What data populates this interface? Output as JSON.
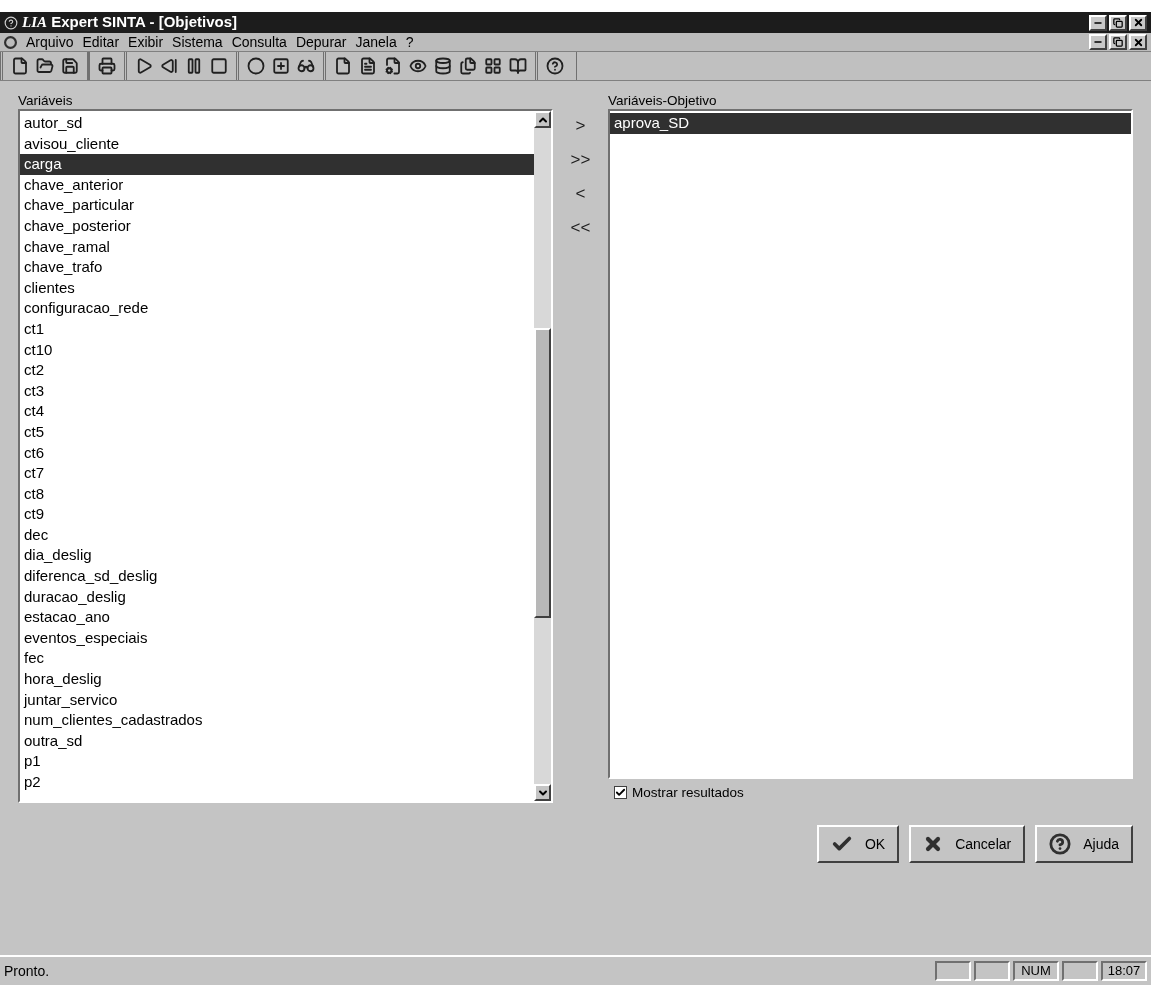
{
  "window": {
    "title_brand": "LIA",
    "title": "Expert SINTA - [Objetivos]"
  },
  "menu": [
    "Arquivo",
    "Editar",
    "Exibir",
    "Sistema",
    "Consulta",
    "Depurar",
    "Janela",
    "?"
  ],
  "variables": {
    "label": "Variáveis",
    "items": [
      {
        "text": "autor_sd",
        "selected": false
      },
      {
        "text": "avisou_cliente",
        "selected": false
      },
      {
        "text": "carga",
        "selected": true
      },
      {
        "text": "chave_anterior",
        "selected": false
      },
      {
        "text": "chave_particular",
        "selected": false
      },
      {
        "text": "chave_posterior",
        "selected": false
      },
      {
        "text": "chave_ramal",
        "selected": false
      },
      {
        "text": "chave_trafo",
        "selected": false
      },
      {
        "text": "clientes",
        "selected": false
      },
      {
        "text": "configuracao_rede",
        "selected": false
      },
      {
        "text": "ct1",
        "selected": false
      },
      {
        "text": "ct10",
        "selected": false
      },
      {
        "text": "ct2",
        "selected": false
      },
      {
        "text": "ct3",
        "selected": false
      },
      {
        "text": "ct4",
        "selected": false
      },
      {
        "text": "ct5",
        "selected": false
      },
      {
        "text": "ct6",
        "selected": false
      },
      {
        "text": "ct7",
        "selected": false
      },
      {
        "text": "ct8",
        "selected": false
      },
      {
        "text": "ct9",
        "selected": false
      },
      {
        "text": "dec",
        "selected": false
      },
      {
        "text": "dia_deslig",
        "selected": false
      },
      {
        "text": "diferenca_sd_deslig",
        "selected": false
      },
      {
        "text": "duracao_deslig",
        "selected": false
      },
      {
        "text": "estacao_ano",
        "selected": false
      },
      {
        "text": "eventos_especiais",
        "selected": false
      },
      {
        "text": "fec",
        "selected": false
      },
      {
        "text": "hora_deslig",
        "selected": false
      },
      {
        "text": "juntar_servico",
        "selected": false
      },
      {
        "text": "num_clientes_cadastrados",
        "selected": false
      },
      {
        "text": "outra_sd",
        "selected": false
      },
      {
        "text": "p1",
        "selected": false
      },
      {
        "text": "p2",
        "selected": false
      }
    ]
  },
  "transfer_buttons": [
    ">",
    ">>",
    "<",
    "<<"
  ],
  "goals": {
    "label": "Variáveis-Objetivo",
    "items": [
      {
        "text": "aprova_SD",
        "selected": true
      }
    ]
  },
  "show_results": {
    "label": "Mostrar resultados",
    "checked": true
  },
  "buttons": [
    {
      "kind": "ok",
      "label": "OK"
    },
    {
      "kind": "cancel",
      "label": "Cancelar"
    },
    {
      "kind": "help",
      "label": "Ajuda"
    }
  ],
  "status_bar": {
    "text": "Pronto.",
    "panels": [
      {
        "kind": "blank"
      },
      {
        "kind": "blank"
      },
      {
        "kind": "text",
        "text": "NUM"
      },
      {
        "kind": "blank"
      },
      {
        "kind": "text",
        "text": "18:07"
      }
    ]
  }
}
